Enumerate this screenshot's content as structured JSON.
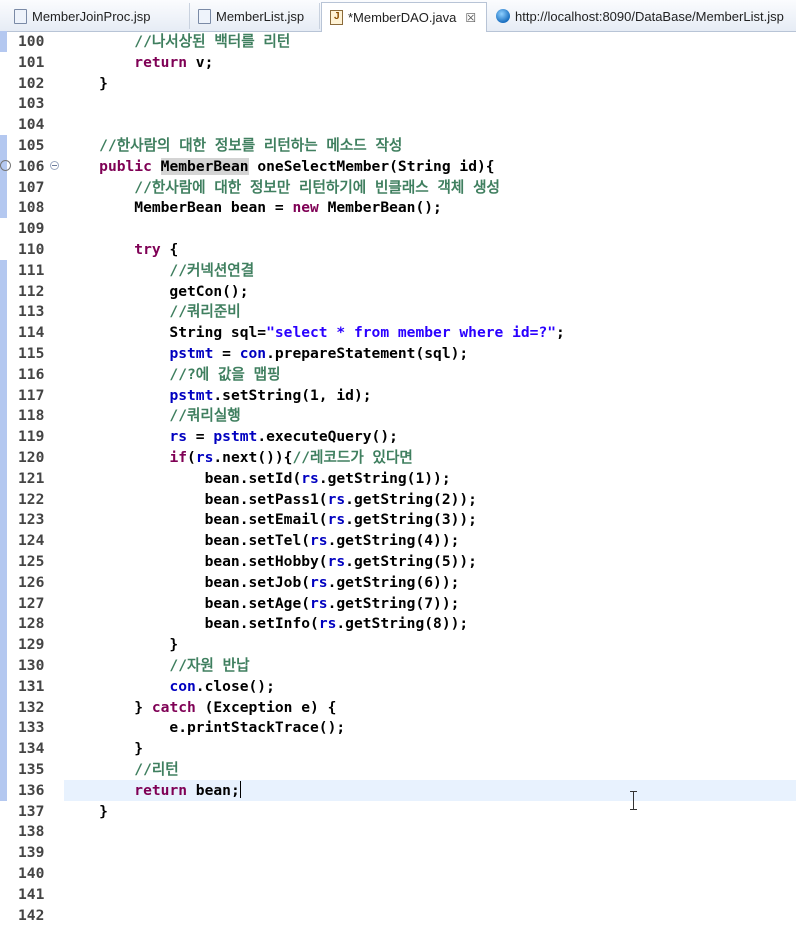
{
  "tabs": [
    {
      "label": "MemberJoinProc.jsp",
      "icon": "jsp-file-icon",
      "active": false
    },
    {
      "label": "MemberList.jsp",
      "icon": "jsp-file-icon",
      "active": false
    },
    {
      "label": "*MemberDAO.java",
      "icon": "java-file-icon",
      "active": true,
      "close": "☒"
    },
    {
      "label": "http://localhost:8090/DataBase/MemberList.jsp",
      "icon": "globe-icon",
      "active": false
    }
  ],
  "editor": {
    "caret_line": 136,
    "lines": [
      {
        "n": "100",
        "parts": [
          [
            "c",
            "        //나서상된 백터를 리턴"
          ]
        ]
      },
      {
        "n": "101",
        "parts": [
          [
            "t",
            "        "
          ],
          [
            "k",
            "return"
          ],
          [
            "t",
            " v;"
          ]
        ]
      },
      {
        "n": "102",
        "parts": [
          [
            "t",
            "    }"
          ]
        ]
      },
      {
        "n": "103",
        "parts": []
      },
      {
        "n": "104",
        "parts": []
      },
      {
        "n": "105",
        "parts": [
          [
            "c",
            "    //한사람의 대한 정보를 리턴하는 메소드 작성"
          ]
        ]
      },
      {
        "n": "106",
        "parts": [
          [
            "t",
            "    "
          ],
          [
            "k",
            "public"
          ],
          [
            "t",
            " "
          ],
          [
            "s",
            "MemberBean"
          ],
          [
            "t",
            " oneSelectMember(String id){"
          ]
        ]
      },
      {
        "n": "107",
        "parts": [
          [
            "c",
            "        //한사람에 대한 정보만 리턴하기에 빈클래스 객체 생성"
          ]
        ]
      },
      {
        "n": "108",
        "parts": [
          [
            "t",
            "        MemberBean bean = "
          ],
          [
            "k",
            "new"
          ],
          [
            "t",
            " MemberBean();"
          ]
        ]
      },
      {
        "n": "109",
        "parts": []
      },
      {
        "n": "110",
        "parts": [
          [
            "t",
            "        "
          ],
          [
            "k",
            "try"
          ],
          [
            "t",
            " {"
          ]
        ]
      },
      {
        "n": "111",
        "parts": [
          [
            "c",
            "            //커넥션연결"
          ]
        ]
      },
      {
        "n": "112",
        "parts": [
          [
            "t",
            "            getCon();"
          ]
        ]
      },
      {
        "n": "113",
        "parts": [
          [
            "c",
            "            //쿼리준비"
          ]
        ]
      },
      {
        "n": "114",
        "parts": [
          [
            "t",
            "            String sql="
          ],
          [
            "q",
            "\"select * from member where id=?\""
          ],
          [
            "t",
            ";"
          ]
        ]
      },
      {
        "n": "115",
        "parts": [
          [
            "t",
            "            "
          ],
          [
            "f",
            "pstmt"
          ],
          [
            "t",
            " = "
          ],
          [
            "f",
            "con"
          ],
          [
            "t",
            ".prepareStatement(sql);"
          ]
        ]
      },
      {
        "n": "116",
        "parts": [
          [
            "c",
            "            //?에 값을 맵핑"
          ]
        ]
      },
      {
        "n": "117",
        "parts": [
          [
            "t",
            "            "
          ],
          [
            "f",
            "pstmt"
          ],
          [
            "t",
            ".setString(1, id);"
          ]
        ]
      },
      {
        "n": "118",
        "parts": [
          [
            "c",
            "            //쿼리실행"
          ]
        ]
      },
      {
        "n": "119",
        "parts": [
          [
            "t",
            "            "
          ],
          [
            "f",
            "rs"
          ],
          [
            "t",
            " = "
          ],
          [
            "f",
            "pstmt"
          ],
          [
            "t",
            ".executeQuery();"
          ]
        ]
      },
      {
        "n": "120",
        "parts": [
          [
            "t",
            "            "
          ],
          [
            "k",
            "if"
          ],
          [
            "t",
            "("
          ],
          [
            "f",
            "rs"
          ],
          [
            "t",
            ".next()){"
          ],
          [
            "c",
            "//레코드가 있다면"
          ]
        ]
      },
      {
        "n": "121",
        "parts": [
          [
            "t",
            "                bean.setId("
          ],
          [
            "f",
            "rs"
          ],
          [
            "t",
            ".getString(1));"
          ]
        ]
      },
      {
        "n": "122",
        "parts": [
          [
            "t",
            "                bean.setPass1("
          ],
          [
            "f",
            "rs"
          ],
          [
            "t",
            ".getString(2));"
          ]
        ]
      },
      {
        "n": "123",
        "parts": [
          [
            "t",
            "                bean.setEmail("
          ],
          [
            "f",
            "rs"
          ],
          [
            "t",
            ".getString(3));"
          ]
        ]
      },
      {
        "n": "124",
        "parts": [
          [
            "t",
            "                bean.setTel("
          ],
          [
            "f",
            "rs"
          ],
          [
            "t",
            ".getString(4));"
          ]
        ]
      },
      {
        "n": "125",
        "parts": [
          [
            "t",
            "                bean.setHobby("
          ],
          [
            "f",
            "rs"
          ],
          [
            "t",
            ".getString(5));"
          ]
        ]
      },
      {
        "n": "126",
        "parts": [
          [
            "t",
            "                bean.setJob("
          ],
          [
            "f",
            "rs"
          ],
          [
            "t",
            ".getString(6));"
          ]
        ]
      },
      {
        "n": "127",
        "parts": [
          [
            "t",
            "                bean.setAge("
          ],
          [
            "f",
            "rs"
          ],
          [
            "t",
            ".getString(7));"
          ]
        ]
      },
      {
        "n": "128",
        "parts": [
          [
            "t",
            "                bean.setInfo("
          ],
          [
            "f",
            "rs"
          ],
          [
            "t",
            ".getString(8));"
          ]
        ]
      },
      {
        "n": "129",
        "parts": [
          [
            "t",
            "            }"
          ]
        ]
      },
      {
        "n": "130",
        "parts": [
          [
            "c",
            "            //자원 반납"
          ]
        ]
      },
      {
        "n": "131",
        "parts": [
          [
            "t",
            "            "
          ],
          [
            "f",
            "con"
          ],
          [
            "t",
            ".close();"
          ]
        ]
      },
      {
        "n": "132",
        "parts": [
          [
            "t",
            "        } "
          ],
          [
            "k",
            "catch"
          ],
          [
            "t",
            " (Exception e) {"
          ]
        ]
      },
      {
        "n": "133",
        "parts": [
          [
            "t",
            "            e.printStackTrace();"
          ]
        ]
      },
      {
        "n": "134",
        "parts": [
          [
            "t",
            "        }"
          ]
        ]
      },
      {
        "n": "135",
        "parts": [
          [
            "c",
            "        //리턴"
          ]
        ]
      },
      {
        "n": "136",
        "parts": [
          [
            "t",
            "        "
          ],
          [
            "k",
            "return"
          ],
          [
            "t",
            " bean;"
          ]
        ]
      },
      {
        "n": "137",
        "parts": [
          [
            "t",
            "    }"
          ]
        ]
      },
      {
        "n": "138",
        "parts": []
      },
      {
        "n": "139",
        "parts": []
      },
      {
        "n": "140",
        "parts": []
      },
      {
        "n": "141",
        "parts": []
      },
      {
        "n": "142",
        "parts": []
      }
    ],
    "changed_lines": [
      "100",
      "105",
      "106",
      "107",
      "108",
      "111",
      "112",
      "113",
      "114",
      "115",
      "116",
      "117",
      "118",
      "119",
      "120",
      "121",
      "122",
      "123",
      "124",
      "125",
      "126",
      "127",
      "128",
      "129",
      "130",
      "131",
      "132",
      "133",
      "134",
      "135",
      "136"
    ],
    "markers": {
      "override_line": "106",
      "fold_line": "106",
      "override_symbol": "⊘"
    }
  },
  "colors": {
    "comment": "#3f7f5f",
    "keyword": "#7f0055",
    "string": "#2a00ff",
    "field": "#0000c0",
    "current_line": "#e8f2fe",
    "change_bar": "#b4c8f0"
  }
}
